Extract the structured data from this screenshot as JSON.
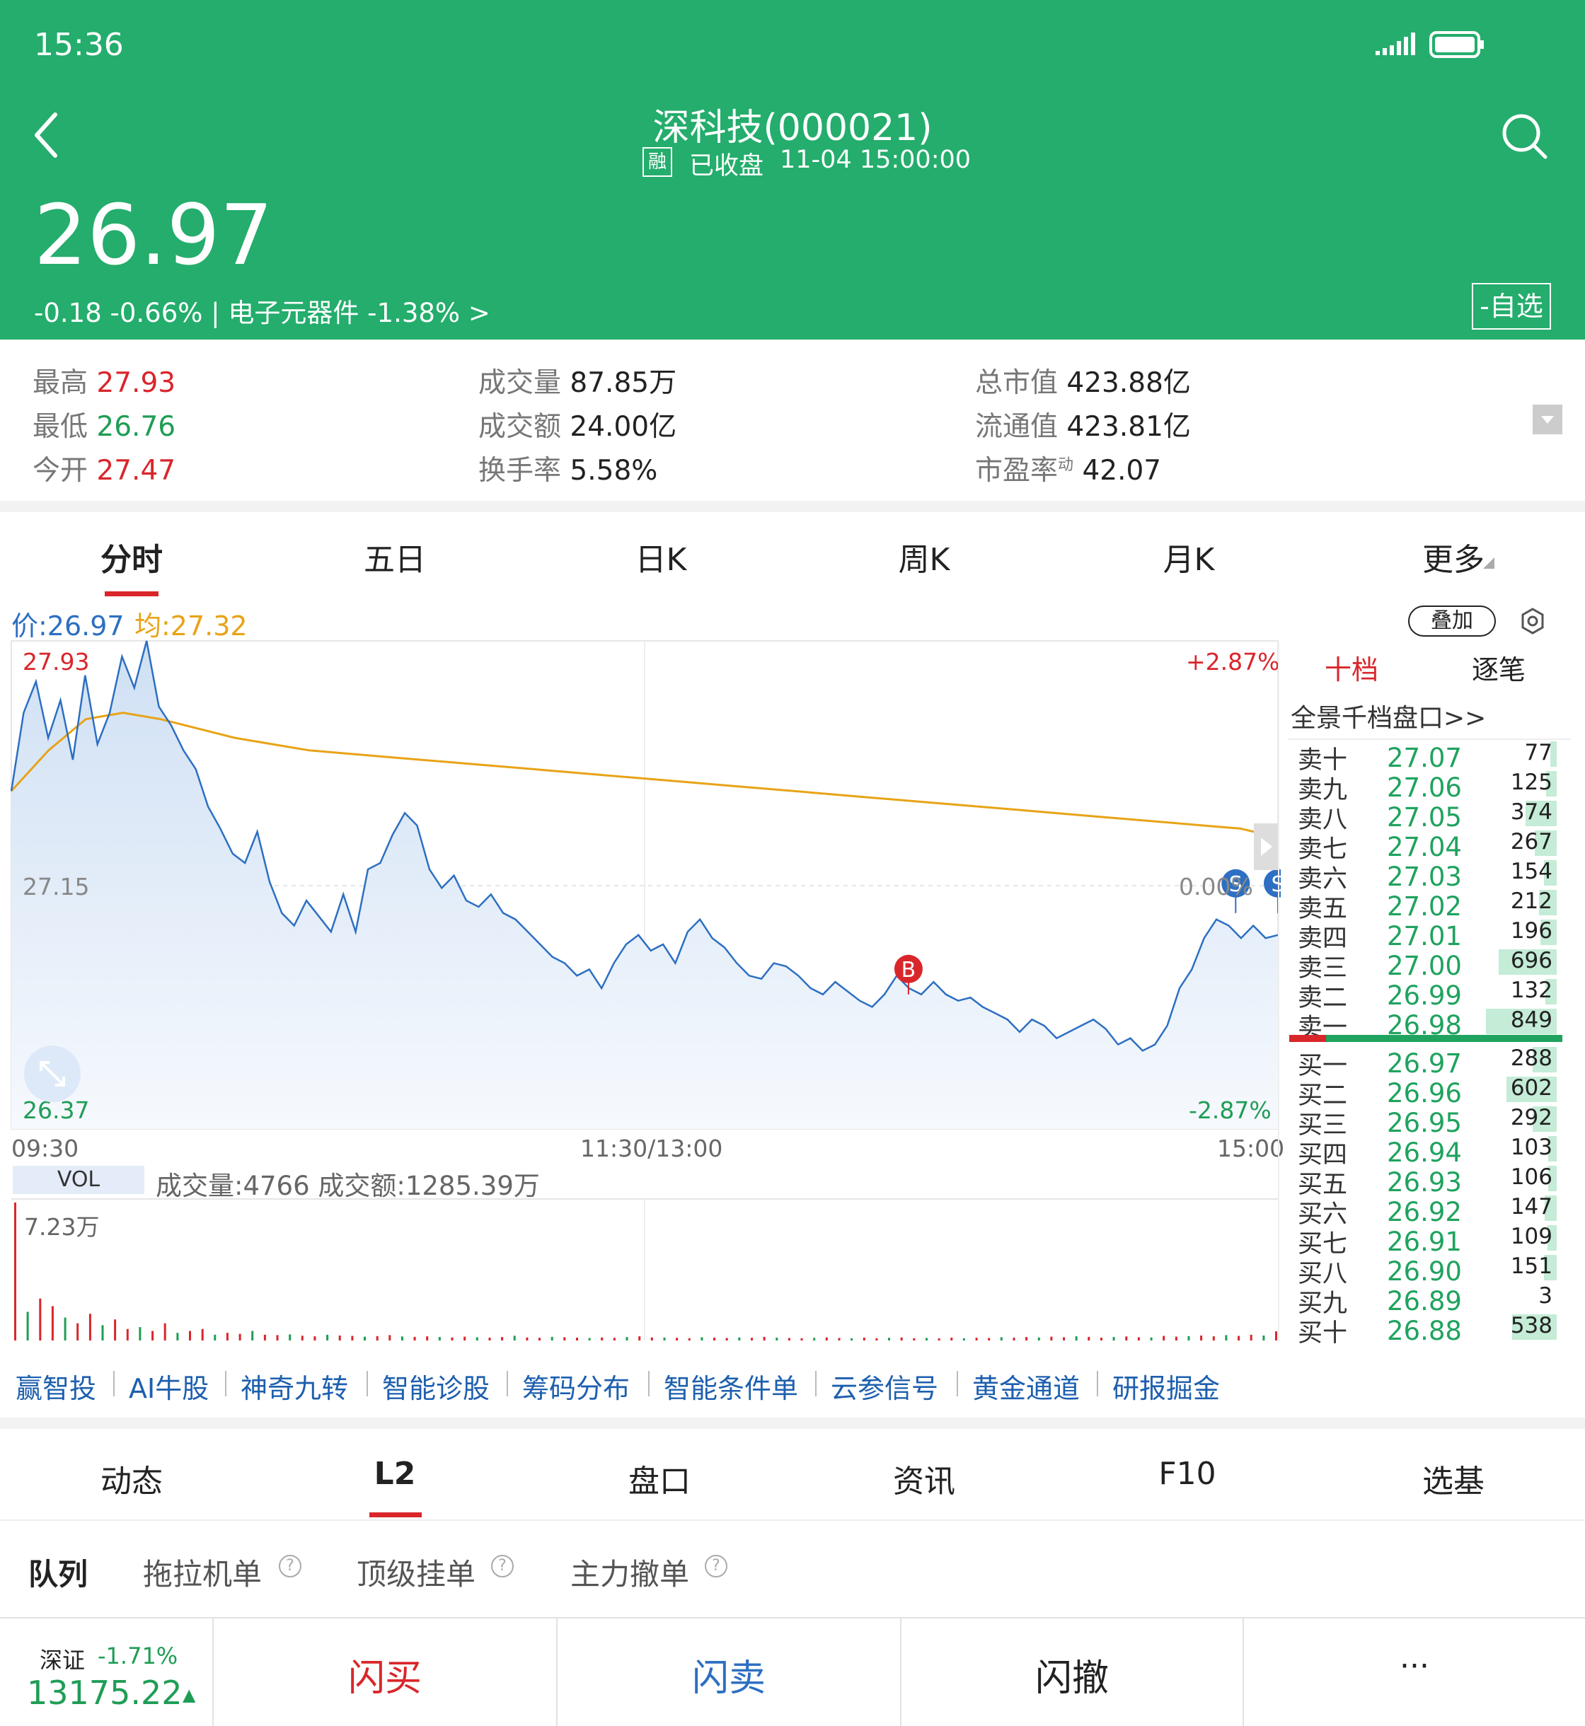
{
  "status_bar": {
    "time": "15:36"
  },
  "header": {
    "title": "深科技(000021)",
    "rong_badge": "融",
    "market_status": "已收盘",
    "datetime": "11-04 15:00:00",
    "price": "26.97",
    "change": "-0.18",
    "change_pct": "-0.66%",
    "sector_sep": "|",
    "sector": "电子元器件",
    "sector_pct": "-1.38%",
    "sector_arrow": ">",
    "watchlist_button": "-自选"
  },
  "stats": {
    "high_label": "最高",
    "high": "27.93",
    "low_label": "最低",
    "low": "26.76",
    "open_label": "今开",
    "open": "27.47",
    "volume_label": "成交量",
    "volume": "87.85万",
    "amount_label": "成交额",
    "amount": "24.00亿",
    "turnover_label": "换手率",
    "turnover": "5.58%",
    "mcap_label": "总市值",
    "mcap": "423.88亿",
    "float_label": "流通值",
    "float": "423.81亿",
    "pe_label": "市盈率",
    "pe_sup": "动",
    "pe": "42.07"
  },
  "chart_tabs": [
    "分时",
    "五日",
    "日K",
    "周K",
    "月K",
    "更多"
  ],
  "chart_header": {
    "price": "价:26.97",
    "avg": "均:27.32",
    "overlay_button": "叠加"
  },
  "chart_labels": {
    "high_price": "27.93",
    "mid_price": "27.15",
    "low_price": "26.37",
    "high_pct": "+2.87%",
    "mid_pct": "0.00%",
    "low_pct": "-2.87%",
    "time_start": "09:30",
    "time_mid": "11:30/13:00",
    "time_end": "15:00",
    "vol_tag": "VOL",
    "vol_info": "成交量:4766 成交额:1285.39万",
    "vol_max": "7.23万",
    "buy_marker": "B",
    "sell_marker": "S"
  },
  "chart_data": {
    "type": "line",
    "x_range": [
      "09:30",
      "15:00"
    ],
    "ylim": [
      26.37,
      27.93
    ],
    "prev_close": 27.15,
    "series": [
      {
        "name": "价",
        "color": "#2d6fc2",
        "values": [
          27.45,
          27.7,
          27.8,
          27.62,
          27.74,
          27.55,
          27.82,
          27.6,
          27.7,
          27.88,
          27.78,
          27.93,
          27.72,
          27.66,
          27.58,
          27.52,
          27.4,
          27.33,
          27.25,
          27.22,
          27.32,
          27.16,
          27.06,
          27.02,
          27.1,
          27.05,
          27.0,
          27.12,
          27.0,
          27.2,
          27.22,
          27.31,
          27.38,
          27.34,
          27.2,
          27.14,
          27.18,
          27.1,
          27.08,
          27.12,
          27.06,
          27.04,
          27.0,
          26.96,
          26.92,
          26.9,
          26.86,
          26.88,
          26.82,
          26.9,
          26.96,
          26.99,
          26.94,
          26.96,
          26.9,
          27.0,
          27.04,
          26.98,
          26.95,
          26.9,
          26.86,
          26.85,
          26.9,
          26.89,
          26.86,
          26.82,
          26.8,
          26.84,
          26.81,
          26.78,
          26.76,
          26.8,
          26.86,
          26.82,
          26.8,
          26.84,
          26.8,
          26.78,
          26.79,
          26.76,
          26.74,
          26.72,
          26.68,
          26.72,
          26.7,
          26.66,
          26.68,
          26.7,
          26.72,
          26.69,
          26.64,
          26.66,
          26.62,
          26.64,
          26.7,
          26.82,
          26.88,
          26.98,
          27.04,
          27.02,
          26.98,
          27.02,
          26.98,
          26.99
        ]
      },
      {
        "name": "均",
        "color": "#e8a317",
        "values": [
          27.45,
          27.58,
          27.68,
          27.7,
          27.68,
          27.65,
          27.62,
          27.6,
          27.58,
          27.57,
          27.56,
          27.55,
          27.54,
          27.53,
          27.52,
          27.51,
          27.5,
          27.49,
          27.48,
          27.47,
          27.46,
          27.45,
          27.44,
          27.43,
          27.42,
          27.41,
          27.4,
          27.39,
          27.38,
          27.37,
          27.36,
          27.35,
          27.34,
          27.33,
          27.32
        ]
      }
    ],
    "trade_markers": [
      {
        "label": "B",
        "time": "13:50",
        "price": 26.8
      },
      {
        "label": "S",
        "time": "14:52",
        "price": 27.06
      },
      {
        "label": "S",
        "time": "15:00",
        "price": 27.06
      }
    ],
    "volume_series": [
      72300,
      15000,
      22000,
      18000,
      12000,
      9000,
      14000,
      8000,
      11000,
      6000,
      7000,
      5000,
      9000,
      4000,
      5000,
      6000,
      3000,
      4000,
      3500,
      5000,
      3000,
      2800,
      3200,
      2500,
      2200,
      3000,
      2600,
      2400,
      2000,
      2300,
      2800,
      2100,
      1900,
      2200,
      1800,
      1600,
      2000,
      1700,
      1500,
      1800,
      2500,
      1600,
      1400,
      1900,
      1700,
      1500,
      1300,
      1600,
      1400,
      1800,
      2200,
      1600,
      1500,
      1400,
      1200,
      1700,
      1500,
      1300,
      1600,
      1400,
      1900,
      1500,
      1300,
      1200,
      1400,
      1600,
      1300,
      1200,
      1500,
      1100,
      1400,
      1600,
      1200,
      1300,
      1100,
      1500,
      1200,
      1400,
      1300,
      1700,
      1500,
      1800,
      1600,
      2000,
      1700,
      2200,
      1900,
      1500,
      1800,
      2100,
      1700,
      1600,
      2400,
      2000,
      2300,
      2600,
      2200,
      2800,
      2400,
      3000,
      2600,
      4766
    ]
  },
  "order_book": {
    "tab_tenlevel": "十档",
    "tab_ticks": "逐笔",
    "panorama_link": "全景千档盘口>>",
    "asks": [
      {
        "label": "卖十",
        "price": "27.07",
        "vol": "77",
        "bar": 0.09
      },
      {
        "label": "卖九",
        "price": "27.06",
        "vol": "125",
        "bar": 0.15
      },
      {
        "label": "卖八",
        "price": "27.05",
        "vol": "374",
        "bar": 0.44
      },
      {
        "label": "卖七",
        "price": "27.04",
        "vol": "267",
        "bar": 0.31
      },
      {
        "label": "卖六",
        "price": "27.03",
        "vol": "154",
        "bar": 0.18
      },
      {
        "label": "卖五",
        "price": "27.02",
        "vol": "212",
        "bar": 0.25
      },
      {
        "label": "卖四",
        "price": "27.01",
        "vol": "196",
        "bar": 0.23
      },
      {
        "label": "卖三",
        "price": "27.00",
        "vol": "696",
        "bar": 0.82
      },
      {
        "label": "卖二",
        "price": "26.99",
        "vol": "132",
        "bar": 0.16
      },
      {
        "label": "卖一",
        "price": "26.98",
        "vol": "849",
        "bar": 1.0
      }
    ],
    "bids": [
      {
        "label": "买一",
        "price": "26.97",
        "vol": "288",
        "bar": 0.34
      },
      {
        "label": "买二",
        "price": "26.96",
        "vol": "602",
        "bar": 0.71
      },
      {
        "label": "买三",
        "price": "26.95",
        "vol": "292",
        "bar": 0.34
      },
      {
        "label": "买四",
        "price": "26.94",
        "vol": "103",
        "bar": 0.12
      },
      {
        "label": "买五",
        "price": "26.93",
        "vol": "106",
        "bar": 0.12
      },
      {
        "label": "买六",
        "price": "26.92",
        "vol": "147",
        "bar": 0.17
      },
      {
        "label": "买七",
        "price": "26.91",
        "vol": "109",
        "bar": 0.13
      },
      {
        "label": "买八",
        "price": "26.90",
        "vol": "151",
        "bar": 0.18
      },
      {
        "label": "买九",
        "price": "26.89",
        "vol": "3",
        "bar": 0.0
      },
      {
        "label": "买十",
        "price": "26.88",
        "vol": "538",
        "bar": 0.63
      }
    ]
  },
  "features": [
    "赢智投",
    "AI牛股",
    "神奇九转",
    "智能诊股",
    "筹码分布",
    "智能条件单",
    "云参信号",
    "黄金通道",
    "研报掘金"
  ],
  "bottom_tabs": [
    "动态",
    "L2",
    "盘口",
    "资讯",
    "F10",
    "选基"
  ],
  "sub_tabs": [
    "队列",
    "拖拉机单",
    "顶级挂单",
    "主力撤单"
  ],
  "help_glyph": "?",
  "footer": {
    "index_name": "深证",
    "index_pct": "-1.71%",
    "index_value": "13175.22",
    "index_arrow": "▲",
    "flash_buy": "闪买",
    "flash_sell": "闪卖",
    "flash_cancel": "闪撤",
    "more": "···"
  }
}
